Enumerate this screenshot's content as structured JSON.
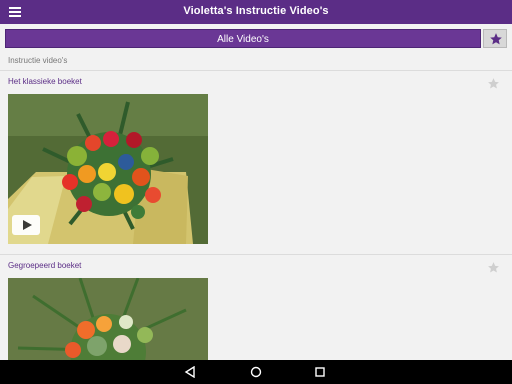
{
  "appbar": {
    "title": "Violetta's Instructie Video's",
    "menu_icon": "hamburger-icon"
  },
  "filter": {
    "label": "Alle Video's",
    "favorite_icon": "star-icon"
  },
  "section": {
    "label": "Instructie video's"
  },
  "videos": [
    {
      "title": "Het klassieke boeket",
      "favorite_icon": "star-outline-icon",
      "play_icon": "play-icon"
    },
    {
      "title": "Gegroepeerd boeket",
      "favorite_icon": "star-outline-icon"
    }
  ],
  "navigation": {
    "back_icon": "back-icon",
    "home_icon": "home-icon",
    "recents_icon": "recents-icon"
  },
  "colors": {
    "primary": "#5b2d86",
    "background": "#f2f2f2",
    "navigation": "#000000"
  }
}
